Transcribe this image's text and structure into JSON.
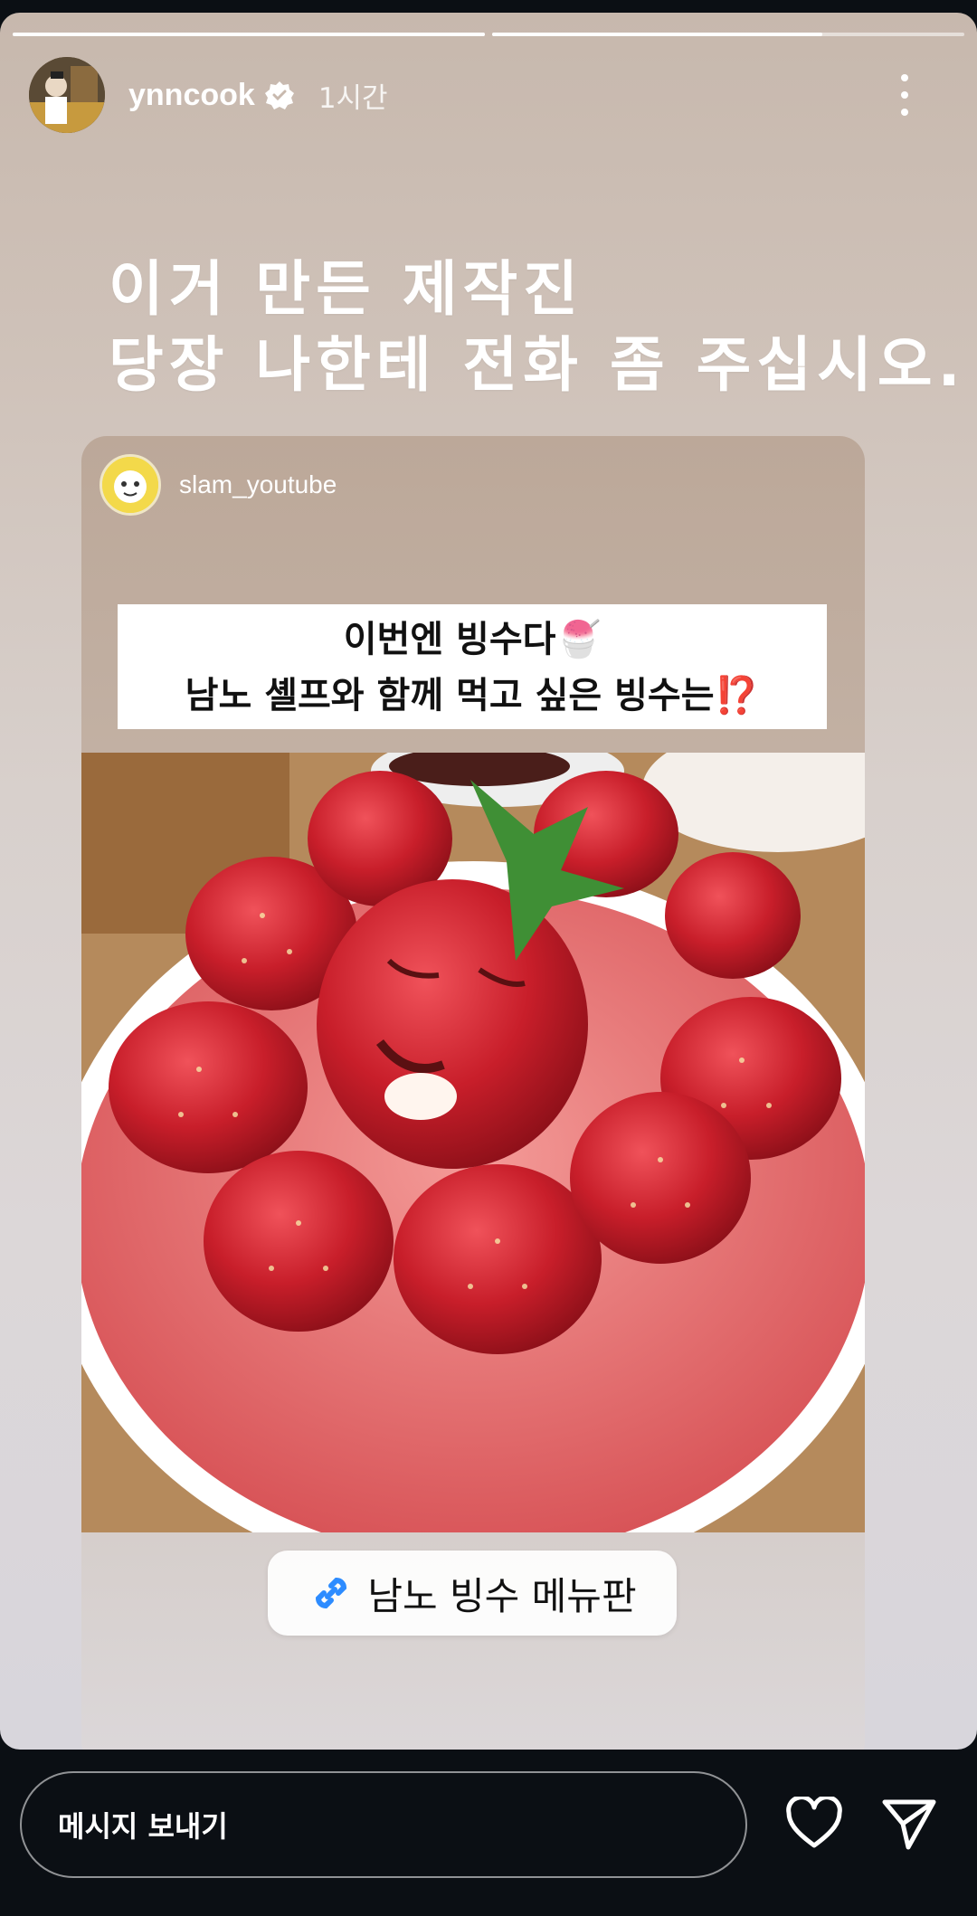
{
  "story": {
    "progress": [
      1.0,
      0.7
    ],
    "user": {
      "username": "ynncook",
      "verified": true,
      "time": "1시간"
    },
    "caption": [
      "이거 만든 제작진",
      "당장 나한테 전화 좀 주십시오."
    ],
    "shared_post": {
      "username": "slam_youtube",
      "text_lines": [
        "이번엔 빙수다🍧",
        "남노 셸프와 함께 먹고 싶은 빙수는⁉️"
      ],
      "image_description_icon": "strawberry-bingsu-photo"
    },
    "link_sticker": {
      "icon": "link-icon",
      "label": "남노 빙수 메뉴판"
    }
  },
  "bottom_bar": {
    "message_placeholder": "메시지 보내기",
    "icons": [
      "heart-icon",
      "send-icon"
    ]
  },
  "colors": {
    "background": "#0b0f14",
    "link_icon": "#2d8cff",
    "strawberry": "#d8242e"
  }
}
